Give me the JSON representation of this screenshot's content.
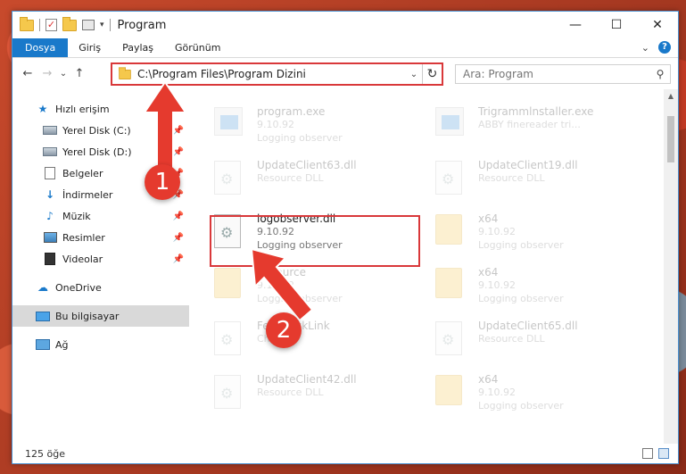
{
  "window": {
    "title": "Program",
    "controls": {
      "minimize": "—",
      "maximize": "☐",
      "close": "✕"
    }
  },
  "ribbon": {
    "tabs": [
      "Dosya",
      "Giriş",
      "Paylaş",
      "Görünüm"
    ],
    "expand": "⌄",
    "help": "?"
  },
  "nav": {
    "back": "←",
    "forward": "→",
    "recent": "⌄",
    "up": "↑"
  },
  "address": {
    "path": "C:\\Program Files\\Program Dizini",
    "dropdown": "⌄",
    "refresh": "↻"
  },
  "search": {
    "placeholder": "Ara: Program"
  },
  "sidebar": {
    "quick_access": "Hızlı erişim",
    "items": [
      {
        "label": "Yerel Disk (C:)"
      },
      {
        "label": "Yerel Disk (D:)"
      },
      {
        "label": "Belgeler"
      },
      {
        "label": "İndirmeler"
      },
      {
        "label": "Müzik"
      },
      {
        "label": "Resimler"
      },
      {
        "label": "Videolar"
      }
    ],
    "onedrive": "OneDrive",
    "this_pc": "Bu bilgisayar",
    "network": "Ağ"
  },
  "files": [
    {
      "name": "program.exe",
      "line2": "9.10.92",
      "line3": "Logging observer",
      "faded": true
    },
    {
      "name": "Trigrammlnstaller.exe",
      "line2": "ABBY finereader tri...",
      "line3": "",
      "faded": true
    },
    {
      "name": "UpdateClient63.dll",
      "line2": "Resource DLL",
      "line3": "",
      "faded": true
    },
    {
      "name": "UpdateClient19.dll",
      "line2": "Resource DLL",
      "line3": "",
      "faded": true
    },
    {
      "name": "logobserver.dll",
      "line2": "9.10.92",
      "line3": "Logging observer",
      "faded": false
    },
    {
      "name": "x64",
      "line2": "9.10.92",
      "line3": "Logging observer",
      "faded": true
    },
    {
      "name": "Resource",
      "line2": "9.10.92",
      "line3": "Logging observer",
      "faded": true
    },
    {
      "name": "x64",
      "line2": "9.10.92",
      "line3": "Logging observer",
      "faded": true
    },
    {
      "name": "FeedbackLink",
      "line2": "Chrome",
      "line3": "",
      "faded": true
    },
    {
      "name": "UpdateClient65.dll",
      "line2": "Resource DLL",
      "line3": "",
      "faded": true
    },
    {
      "name": "UpdateClient42.dll",
      "line2": "Resource DLL",
      "line3": "",
      "faded": true
    },
    {
      "name": "x64",
      "line2": "9.10.92",
      "line3": "Logging observer",
      "faded": true
    }
  ],
  "status": {
    "count": "125 öğe"
  },
  "annotations": {
    "step1": "1",
    "step2": "2",
    "color": "#e53a2e"
  }
}
